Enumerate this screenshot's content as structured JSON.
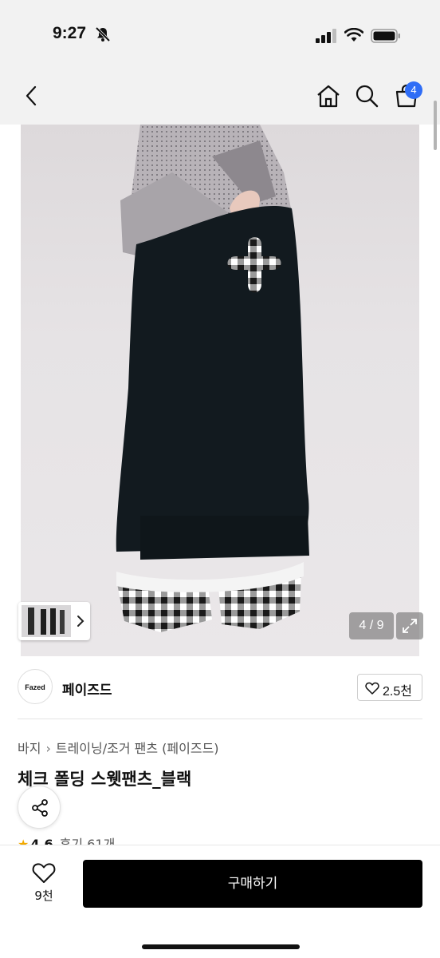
{
  "status_bar": {
    "time": "9:27",
    "battery_icon": "battery-icon",
    "wifi_icon": "wifi-icon",
    "signal_icon": "cellular-signal-icon",
    "mute_icon": "bell-slash-icon"
  },
  "nav": {
    "cart_badge": "4"
  },
  "gallery": {
    "page_counter": "4 / 9"
  },
  "brand": {
    "logo_text": "Fazed",
    "name": "페이즈드",
    "like_count": "2.5천"
  },
  "breadcrumb": {
    "category": "바지",
    "subcategory": "트레이닝/조거 팬츠 (페이즈드)"
  },
  "product": {
    "title": "체크 폴딩 스웻팬츠_블랙"
  },
  "rating": {
    "value": "4.6",
    "reviews": "후기 61개"
  },
  "bottom_bar": {
    "wish_count": "9천",
    "buy_label": "구매하기"
  },
  "colors": {
    "accent_badge": "#2f6df6",
    "buy_button": "#000000",
    "star": "#f2a900"
  }
}
